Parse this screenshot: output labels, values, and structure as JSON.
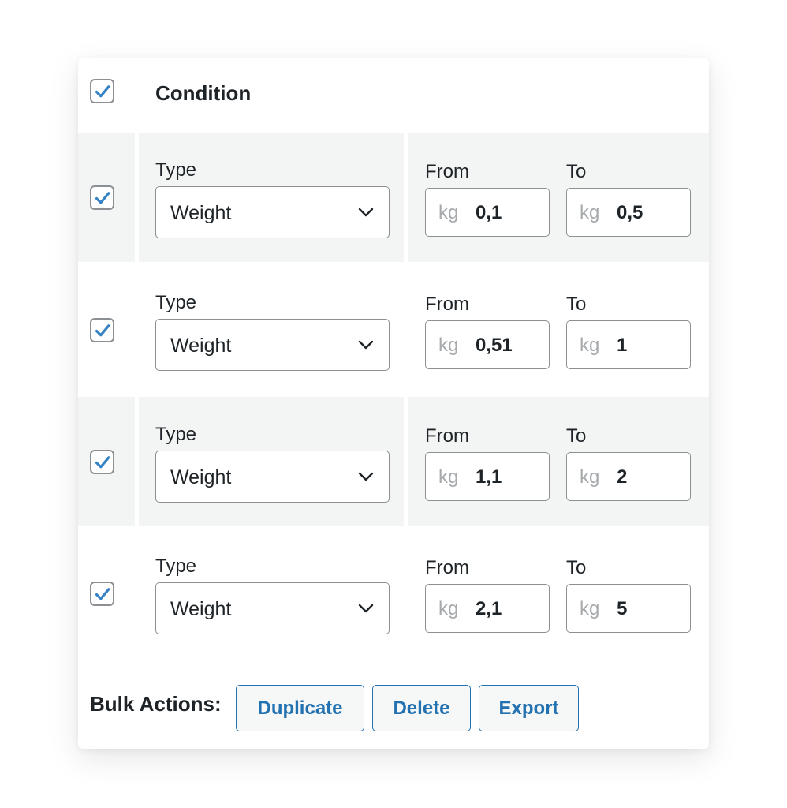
{
  "header": {
    "title": "Condition",
    "checked": true
  },
  "rows": [
    {
      "type_label": "Type",
      "type_value": "Weight",
      "from_label": "From",
      "to_label": "To",
      "unit": "kg",
      "from_value": "0,1",
      "to_value": "0,5",
      "checked": true
    },
    {
      "type_label": "Type",
      "type_value": "Weight",
      "from_label": "From",
      "to_label": "To",
      "unit": "kg",
      "from_value": "0,51",
      "to_value": "1",
      "checked": true
    },
    {
      "type_label": "Type",
      "type_value": "Weight",
      "from_label": "From",
      "to_label": "To",
      "unit": "kg",
      "from_value": "1,1",
      "to_value": "2",
      "checked": true
    },
    {
      "type_label": "Type",
      "type_value": "Weight",
      "from_label": "From",
      "to_label": "To",
      "unit": "kg",
      "from_value": "2,1",
      "to_value": "5",
      "checked": true
    }
  ],
  "bulk": {
    "label": "Bulk Actions:",
    "duplicate": "Duplicate",
    "delete": "Delete",
    "export": "Export"
  },
  "colors": {
    "accent": "#2271b1",
    "check": "#3582c4",
    "row_shade": "#f3f5f4",
    "border": "#8c8f94"
  },
  "icons": {
    "checkbox": "checkmark-icon",
    "select": "chevron-down-icon"
  }
}
